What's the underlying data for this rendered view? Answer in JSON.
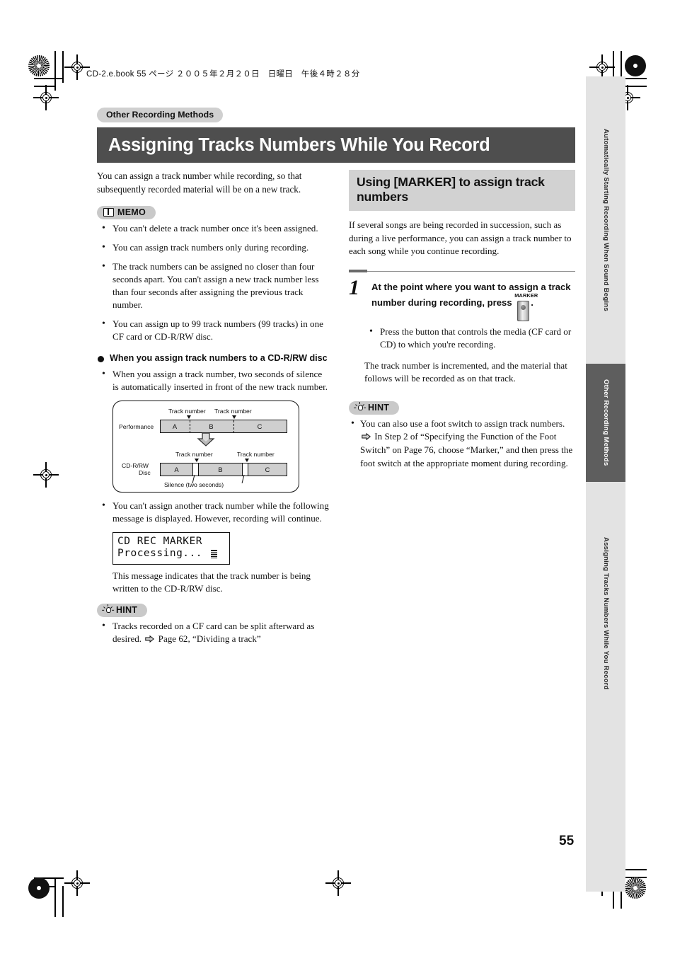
{
  "header": {
    "file_line": "CD-2.e.book  55 ページ  ２００５年２月２０日　日曜日　午後４時２８分"
  },
  "chapter_tag": "Other Recording Methods",
  "page_title": "Assigning Tracks Numbers While You Record",
  "page_number": "55",
  "left_column": {
    "intro": "You can assign a track number while recording, so that subsequently recorded material will be on a new track.",
    "memo": {
      "label": "MEMO",
      "icon": "book-icon",
      "items": [
        "You can't delete a track number once it's been assigned.",
        "You can assign track numbers only during recording.",
        "The track numbers can be assigned no closer than four seconds apart. You can't assign a new track number less than four seconds after assigning the previous track number.",
        "You can assign up to 99 track numbers (99 tracks) in one CF card or CD-R/RW disc."
      ]
    },
    "subhead": "When you assign track numbers to a CD-R/RW disc",
    "subhead_items": [
      "When you assign a track number, two seconds of silence is automatically inserted in front of the new track number."
    ],
    "diagram": {
      "row1_label": "Performance",
      "row2_label_line1": "CD-R/RW",
      "row2_label_line2": "Disc",
      "track_number_label": "Track number",
      "silence_label": "Silence (two seconds)",
      "segments": [
        "A",
        "B",
        "C"
      ]
    },
    "lcd_intro": "You can't assign another track number while the following message is displayed. However, recording will continue.",
    "lcd": {
      "line1": "CD REC MARKER",
      "line2": "Processing..."
    },
    "lcd_caption": "This message indicates that the track number is being written to the CD-R/RW disc.",
    "hint": {
      "label": "HINT",
      "icon": "bulb-icon",
      "item_a": "Tracks recorded on a CF card can be split afterward as desired.",
      "item_b": "Page 62, “Dividing a track”"
    }
  },
  "right_column": {
    "section_heading": "Using [MARKER] to assign track numbers",
    "section_para": "If several songs are being recorded in succession, such as during a live performance, you can assign a track number to each song while you continue recording.",
    "step": {
      "number": "1",
      "text_a": "At the point where you want to assign a track number during recording, press",
      "button_label": "MARKER",
      "text_b": "."
    },
    "substep_items": [
      "Press the button that controls the media (CF card or CD) to which you're recording."
    ],
    "result_note": "The track number is incremented, and the material that follows will be recorded as on that track.",
    "hint": {
      "label": "HINT",
      "icon": "bulb-icon",
      "item_a": "You can also use a foot switch to assign track numbers.",
      "item_b": "In Step 2 of “Specifying the Function of the Foot Switch” on Page 76, choose “Marker,” and then press the foot switch at the appropriate moment during recording."
    }
  },
  "sidebar": {
    "tabs": [
      {
        "label": "Automatically Starting Recording When Sound Begins",
        "active": false
      },
      {
        "label": "Other Recording Methods",
        "active": true
      },
      {
        "label": "Assigning Tracks Numbers While You Record",
        "active": false
      }
    ]
  }
}
